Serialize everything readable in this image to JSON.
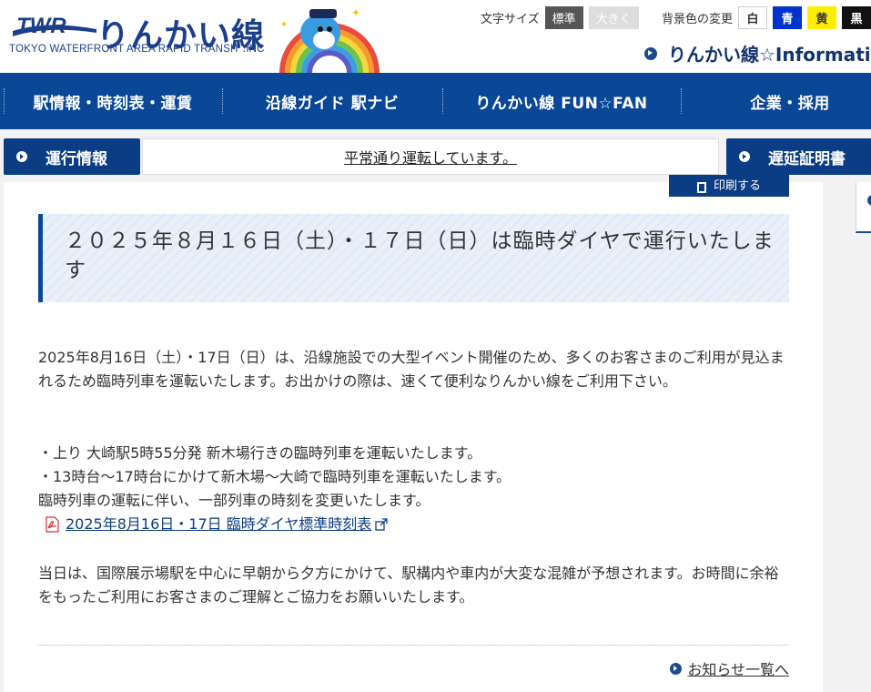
{
  "header": {
    "logo_mark": "TWR",
    "logo_name": "りんかい線",
    "logo_sub": "TOKYO WATERFRONT AREA RAPID TRANSIT .INC",
    "font_size_label": "文字サイズ",
    "font_size_standard": "標準",
    "font_size_large": "大きく",
    "bg_color_label": "背景色の変更",
    "bg_white": "白",
    "bg_blue": "青",
    "bg_yellow": "黄",
    "bg_black": "黒",
    "info_link": "りんかい線☆Information"
  },
  "nav": {
    "items": [
      {
        "label": "駅情報・時刻表・運賃"
      },
      {
        "label": "沿線ガイド 駅ナビ"
      },
      {
        "label": "りんかい線 FUN☆FAN"
      },
      {
        "label": "企業・採用"
      }
    ]
  },
  "status": {
    "operation_label": "運行情報",
    "message": "平常通り運転しています。",
    "delay_cert_label": "遅延証明書"
  },
  "article": {
    "print_label": "印刷する",
    "title": "２０２５年８月１６日（土）・１７日（日）は臨時ダイヤで運行いたします",
    "paragraph1": "2025年8月16日（土）・17日（日）は、沿線施設での大型イベント開催のため、多くのお客さまのご利用が見込まれるため臨時列車を運転いたします。お出かけの際は、速くて便利なりんかい線をご利用下さい。",
    "bullet1": "・上り 大崎駅5時55分発 新木場行きの臨時列車を運転いたします。",
    "bullet2": "・13時台～17時台にかけて新木場～大崎で臨時列車を運転いたします。",
    "note": "臨時列車の運転に伴い、一部列車の時刻を変更いたします。",
    "pdf_link": "2025年8月16日・17日 臨時ダイヤ標準時刻表",
    "paragraph3": "当日は、国際展示場駅を中心に早朝から夕方にかけて、駅構内や車内が大変な混雑が予想されます。お時間に余裕をもったご利用にお客さまのご理解とご協力をお願いいたします。",
    "more_link": "お知らせ一覧へ"
  },
  "colors": {
    "brand_blue": "#0b4797",
    "button_navy": "#0b3d84",
    "title_bar": "#0b4797"
  }
}
